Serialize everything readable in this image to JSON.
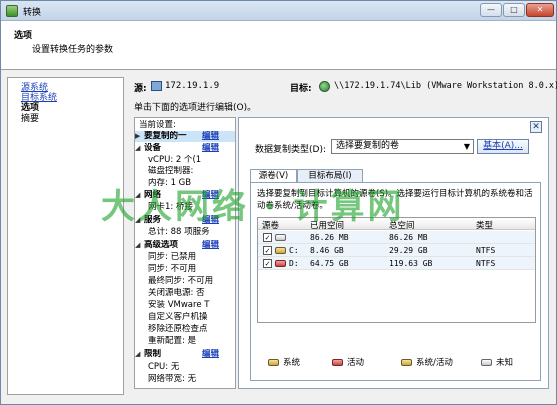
{
  "window": {
    "title": "转换"
  },
  "header": {
    "title": "选项",
    "subtitle": "设置转换任务的参数"
  },
  "nav": {
    "items": [
      {
        "label": "源系统",
        "link": true
      },
      {
        "label": "目标系统",
        "link": true
      },
      {
        "label": "选项",
        "current": true
      },
      {
        "label": "摘要"
      }
    ]
  },
  "source": {
    "label": "源:",
    "value": "172.19.1.9"
  },
  "target": {
    "label": "目标:",
    "value": "\\\\172.19.1.74\\Lib (VMware Workstation 8.0.x)"
  },
  "instruction": "单击下面的选项进行编辑(O)。",
  "tree": {
    "header": "当前设置:",
    "edit_label": "编辑",
    "rows": [
      {
        "type": "section",
        "label": "要复制的一",
        "selected": true,
        "arrow": "▶"
      },
      {
        "type": "section",
        "label": "设备",
        "arrow": "◢"
      },
      {
        "type": "item",
        "label": "vCPU: 2 个(1 "
      },
      {
        "type": "item",
        "label": "磁盘控制器: "
      },
      {
        "type": "item",
        "label": "内存: 1 GB"
      },
      {
        "type": "section",
        "label": "网络",
        "arrow": "◢"
      },
      {
        "type": "item",
        "label": "网卡1: 桥接"
      },
      {
        "type": "section",
        "label": "服务",
        "arrow": "◢"
      },
      {
        "type": "item",
        "label": "总计: 88 项服务"
      },
      {
        "type": "section",
        "label": "高级选项",
        "arrow": "◢"
      },
      {
        "type": "item",
        "label": "同步: 已禁用"
      },
      {
        "type": "item",
        "label": "同步: 不可用"
      },
      {
        "type": "item",
        "label": "最终同步: 不可用"
      },
      {
        "type": "item",
        "label": "关闭源电源: 否"
      },
      {
        "type": "item",
        "label": "安装 VMware T"
      },
      {
        "type": "item",
        "label": "自定义客户机操"
      },
      {
        "type": "item",
        "label": "移除还原检查点"
      },
      {
        "type": "item",
        "label": "重新配置: 是"
      },
      {
        "type": "section",
        "label": "限制",
        "arrow": "◢"
      },
      {
        "type": "item",
        "label": "CPU: 无"
      },
      {
        "type": "item",
        "label": "网络带宽: 无"
      }
    ]
  },
  "panel": {
    "close_glyph": "✕",
    "dup_label": "数据复制类型(D):",
    "dup_value": "选择要复制的卷",
    "dup_arrow": "▼",
    "basic_button": "基本(A)...",
    "tabs": [
      {
        "label": "源卷(V)",
        "active": true
      },
      {
        "label": "目标布局(I)"
      }
    ],
    "description": "选择要复制到目标计算机的源卷(S)。选择要运行目标计算机的系统卷和活动卷系统/活动卷。",
    "columns": [
      "源卷",
      "已用空间",
      "总空间",
      "类型"
    ],
    "rows": [
      {
        "checked": "✓",
        "drive": "",
        "used": "86.26 MB",
        "total": "86.26 MB",
        "fs": "",
        "icon": "unknown"
      },
      {
        "checked": "✓",
        "drive": "C:",
        "used": "8.46 GB",
        "total": "29.29 GB",
        "fs": "NTFS",
        "icon": "system"
      },
      {
        "checked": "✓",
        "drive": "D:",
        "used": "64.75 GB",
        "total": "119.63 GB",
        "fs": "NTFS",
        "icon": "active"
      }
    ],
    "legend": [
      {
        "label": "系统",
        "icon": "system"
      },
      {
        "label": "活动",
        "icon": "active"
      },
      {
        "label": "系统/活动",
        "icon": "system"
      },
      {
        "label": "未知",
        "icon": "unknown"
      }
    ]
  },
  "watermark": "大人网络 · 计算网"
}
